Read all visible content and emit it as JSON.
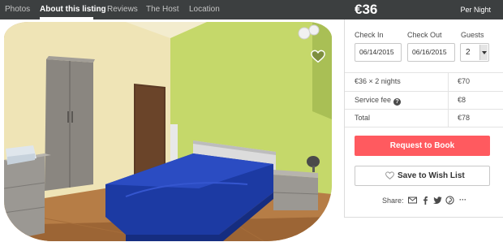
{
  "nav": {
    "tabs": [
      "Photos",
      "About this listing",
      "Reviews",
      "The Host",
      "Location"
    ],
    "active_tab": "About this listing"
  },
  "booking": {
    "price": "€36",
    "per_night": "Per Night",
    "check_in_label": "Check In",
    "check_in_value": "06/14/2015",
    "check_out_label": "Check Out",
    "check_out_value": "06/16/2015",
    "guests_label": "Guests",
    "guests_value": "2",
    "line_items": [
      {
        "label": "€36 × 2 nights",
        "value": "€70"
      },
      {
        "label": "Service fee",
        "value": "€8"
      },
      {
        "label": "Total",
        "value": "€78"
      }
    ],
    "request_button": "Request to Book",
    "wishlist_button": "Save to Wish List",
    "share_label": "Share:",
    "share_icons": [
      "mail-icon",
      "facebook-icon",
      "twitter-icon",
      "pinterest-icon",
      "more-icon"
    ],
    "share_more": "···"
  },
  "colors": {
    "nav_bg": "#3c3f40",
    "accent": "#ff5a5f",
    "wall_green": "#c5d86a",
    "bed_blue": "#1c3aa3"
  }
}
